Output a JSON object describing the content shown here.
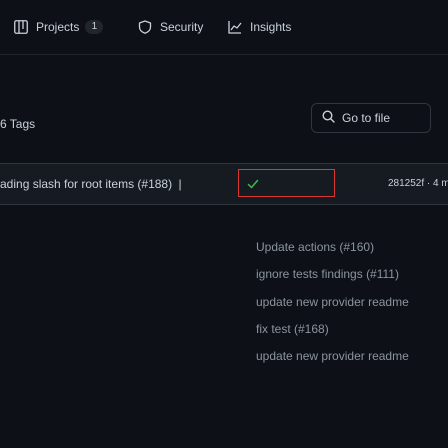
{
  "nav": {
    "projects": {
      "label": "Projects",
      "count": "1",
      "icon": "project-board-icon"
    },
    "security": {
      "label": "Security",
      "icon": "shield-icon"
    },
    "insights": {
      "label": "Insights",
      "icon": "graph-icon"
    }
  },
  "file_nav": {
    "tags_label": "6 Tags",
    "goto_label": "Go to file",
    "goto_icon": "search-icon"
  },
  "latest_commit": {
    "message": "ading slash for root items (#188)",
    "separator": "|",
    "status_icon": "check-icon",
    "hash_time": "281252f · 4 m"
  },
  "file_commits": [
    "Update actions (#160)",
    "ignore tests findings (#111)",
    "update new provider readme",
    "fix test (#168)",
    "update new provider readme"
  ],
  "colors": {
    "background": "#0d1117",
    "text": "#c9d1d9",
    "muted": "#8b949e",
    "border": "#30363d",
    "focus": "#da3633"
  }
}
